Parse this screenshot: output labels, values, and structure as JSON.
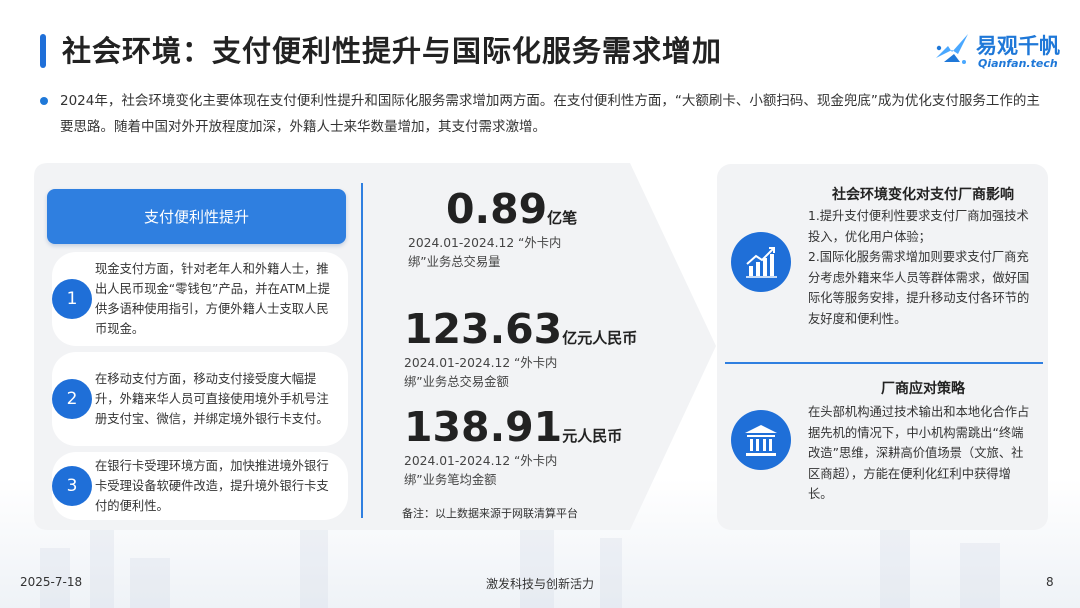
{
  "header": {
    "title": "社会环境：支付便利性提升与国际化服务需求增加",
    "logo_name": "易观千帆",
    "logo_url": "Qianfan.tech",
    "accent": "#1f6fd8"
  },
  "intro": "2024年，社会环境变化主要体现在支付便利性提升和国际化服务需求增加两方面。在支付便利性方面，“大额刷卡、小额扫码、现金兜底”成为优化支付服务工作的主要思路。随着中国对外开放程度加深，外籍人士来华数量增加，其支付需求激增。",
  "left": {
    "heading": "支付便利性提升",
    "items": [
      {
        "num": "1",
        "text": "现金支付方面，针对老年人和外籍人士，推出人民币现金“零钱包”产品，并在ATM上提供多语种使用指引，方便外籍人士支取人民币现金。"
      },
      {
        "num": "2",
        "text": "在移动支付方面，移动支付接受度大幅提升，外籍来华人员可直接使用境外手机号注册支付宝、微信，并绑定境外银行卡支付。"
      },
      {
        "num": "3",
        "text": "在银行卡受理环境方面，加快推进境外银行卡受理设备软硬件改造，提升境外银行卡支付的便利性。"
      }
    ]
  },
  "stats": [
    {
      "value": "0.89",
      "unit": "亿笔",
      "label": "2024.01-2024.12 “外卡内绑”业务总交易量"
    },
    {
      "value": "123.63",
      "unit": "亿元人民币",
      "label": "2024.01-2024.12 “外卡内绑”业务总交易金额"
    },
    {
      "value": "138.91",
      "unit": "元人民币",
      "label": "2024.01-2024.12 “外卡内绑”业务笔均金额"
    }
  ],
  "note": "备注：以上数据来源于网联清算平台",
  "right": {
    "impact": {
      "icon": "chart-growth-icon",
      "title": "社会环境变化对支付厂商影响",
      "body": "1.提升支付便利性要求支付厂商加强技术投入，优化用户体验；\n2.国际化服务需求增加则要求支付厂商充分考虑外籍来华人员等群体需求，做好国际化等服务安排，提升移动支付各环节的友好度和便利性。"
    },
    "strategy": {
      "icon": "bank-building-icon",
      "title": "厂商应对策略",
      "body": "在头部机构通过技术输出和本地化合作占据先机的情况下，中小机构需跳出“终端改造”思维，深耕高价值场景（文旅、社区商超），方能在便利化红利中获得增长。"
    }
  },
  "footer": {
    "date": "2025-7-18",
    "center": "激发科技与创新活力",
    "page": "8"
  }
}
